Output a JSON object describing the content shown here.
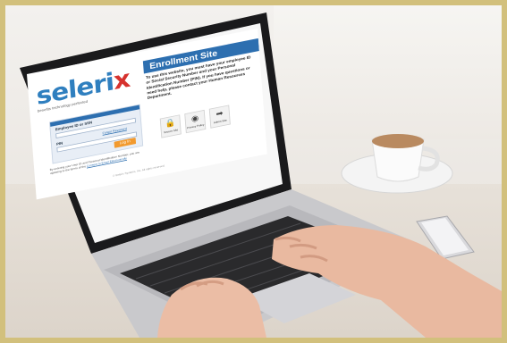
{
  "screen": {
    "logo": {
      "text": "seleri",
      "accent": "x",
      "tagline": "benefits technology perfected"
    },
    "banner_title": "Enrollment Site",
    "info_text": "To use this website, you must have your employee ID or Social Security Number and your Personal Identification Number (PIN). If you have questions or need help, please contact your Human Resources Department.",
    "login": {
      "employee_label": "Employee ID or SSN",
      "pin_label": "PIN",
      "forgot_label": "Forgot Password",
      "button_label": "Log In"
    },
    "consent_text": "By entering your User ID and Personal Identification Number, you are agreeing to the terms of the",
    "consent_link": "Consent to Email Electronically",
    "tiles": [
      {
        "icon": "lock-icon",
        "glyph": "🔒",
        "label": "Secure Site"
      },
      {
        "icon": "eye-icon",
        "glyph": "◉",
        "label": "Privacy Policy"
      },
      {
        "icon": "arrow-right-icon",
        "glyph": "➡",
        "label": "Admin Site"
      }
    ],
    "footer": "© Selerix Systems, Inc. All rights reserved."
  },
  "colors": {
    "frame": "#d2c07c",
    "brand_blue": "#2d6fb0",
    "logo_red": "#d6322e",
    "login_orange": "#f29a2e"
  }
}
